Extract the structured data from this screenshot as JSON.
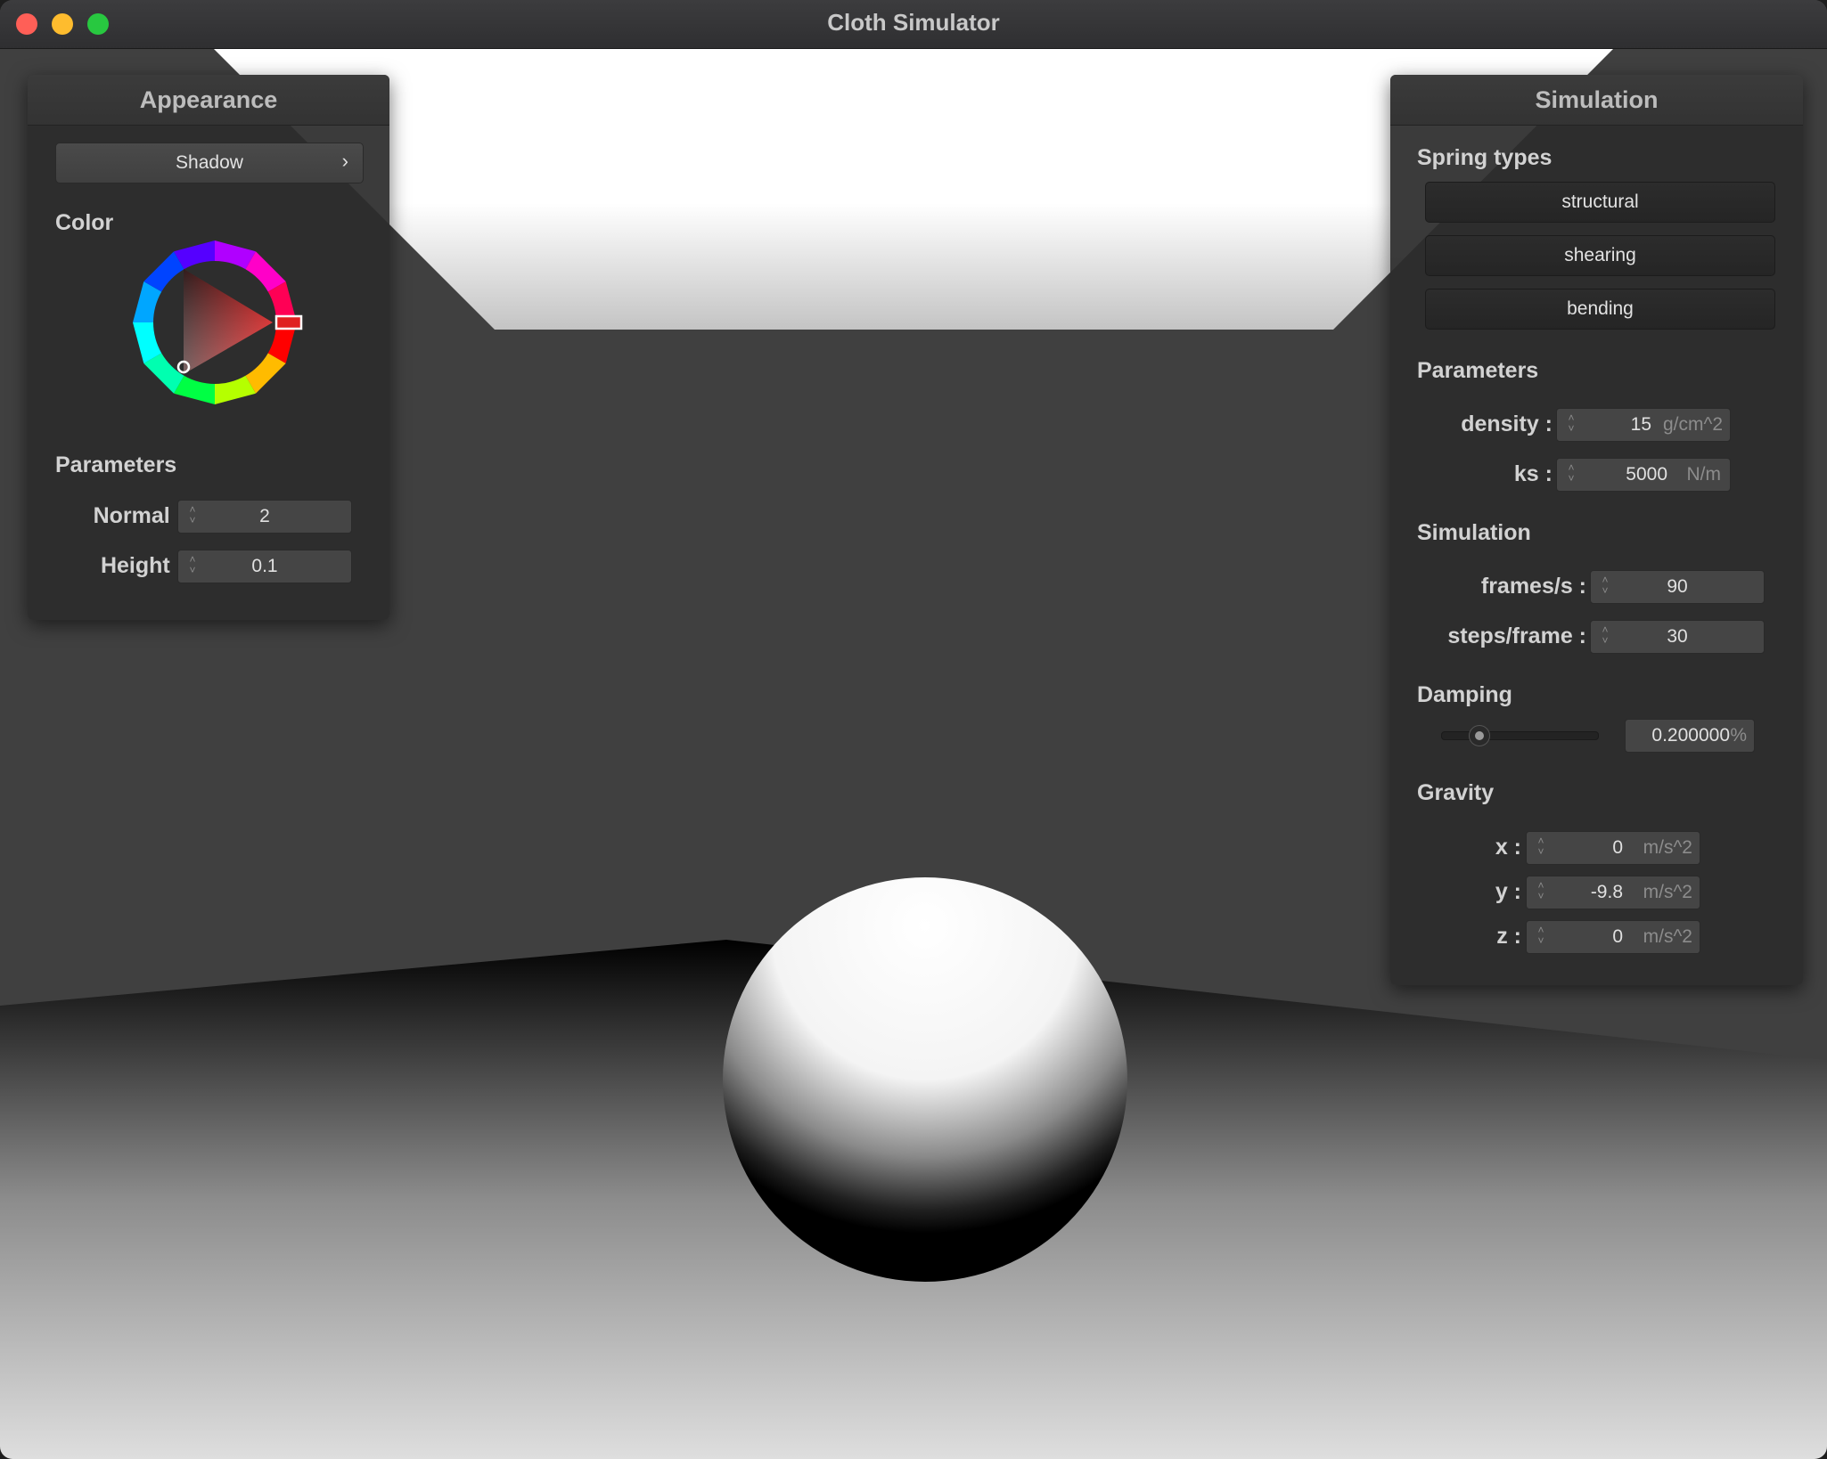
{
  "window": {
    "title": "Cloth Simulator"
  },
  "appearance": {
    "header": "Appearance",
    "shadow_button": "Shadow",
    "chevron": "›",
    "color_label": "Color",
    "color_value": "#ff0000",
    "params_label": "Parameters",
    "normal_label": "Normal :",
    "normal_value": "2",
    "height_label": "Height :",
    "height_value": "0.1"
  },
  "simulation": {
    "header": "Simulation",
    "spring_types_label": "Spring types",
    "spring_types": [
      "structural",
      "shearing",
      "bending"
    ],
    "params_label": "Parameters",
    "density_label": "density :",
    "density_value": "15",
    "density_unit": "g/cm^2",
    "ks_label": "ks :",
    "ks_value": "5000",
    "ks_unit": "N/m",
    "sim_label": "Simulation",
    "fps_label": "frames/s :",
    "fps_value": "90",
    "steps_label": "steps/frame :",
    "steps_value": "30",
    "damping_label": "Damping",
    "damping_value": "0.200000",
    "damping_unit": "%",
    "damping_level": 0.2,
    "gravity_label": "Gravity",
    "gx_label": "x :",
    "gx_value": "0",
    "gy_label": "y :",
    "gy_value": "-9.8",
    "gz_label": "z :",
    "gz_value": "0",
    "gravity_unit": "m/s^2"
  }
}
